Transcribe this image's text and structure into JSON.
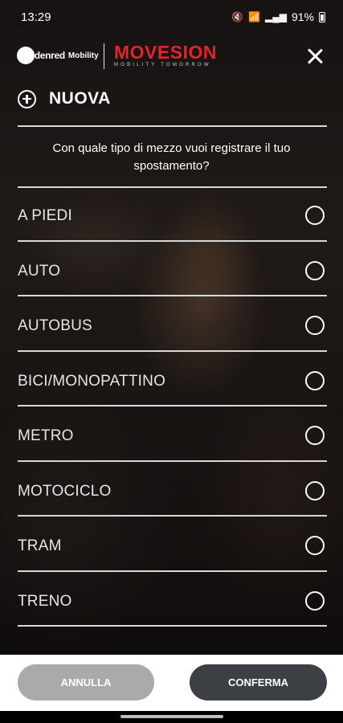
{
  "status_bar": {
    "time": "13:29",
    "battery": "91%",
    "icons": [
      "mute-icon",
      "wifi-icon",
      "signal-icon",
      "battery-icon"
    ]
  },
  "header": {
    "logo_left_circle": "Edenred",
    "logo_left_text": "Mobility",
    "logo_right": "MOVESION",
    "logo_right_tagline": "MOBILITY TOMORROW",
    "brand_color": "#e0242e"
  },
  "title": "NUOVA",
  "question": "Con quale tipo di mezzo vuoi registrare il tuo spostamento?",
  "options": [
    {
      "label": "A PIEDI",
      "selected": false
    },
    {
      "label": "AUTO",
      "selected": false
    },
    {
      "label": "AUTOBUS",
      "selected": false
    },
    {
      "label": "BICI/MONOPATTINO",
      "selected": false
    },
    {
      "label": "METRO",
      "selected": false
    },
    {
      "label": "MOTOCICLO",
      "selected": false
    },
    {
      "label": "TRAM",
      "selected": false
    },
    {
      "label": "TRENO",
      "selected": false
    }
  ],
  "buttons": {
    "cancel": "ANNULLA",
    "confirm": "CONFERMA"
  }
}
